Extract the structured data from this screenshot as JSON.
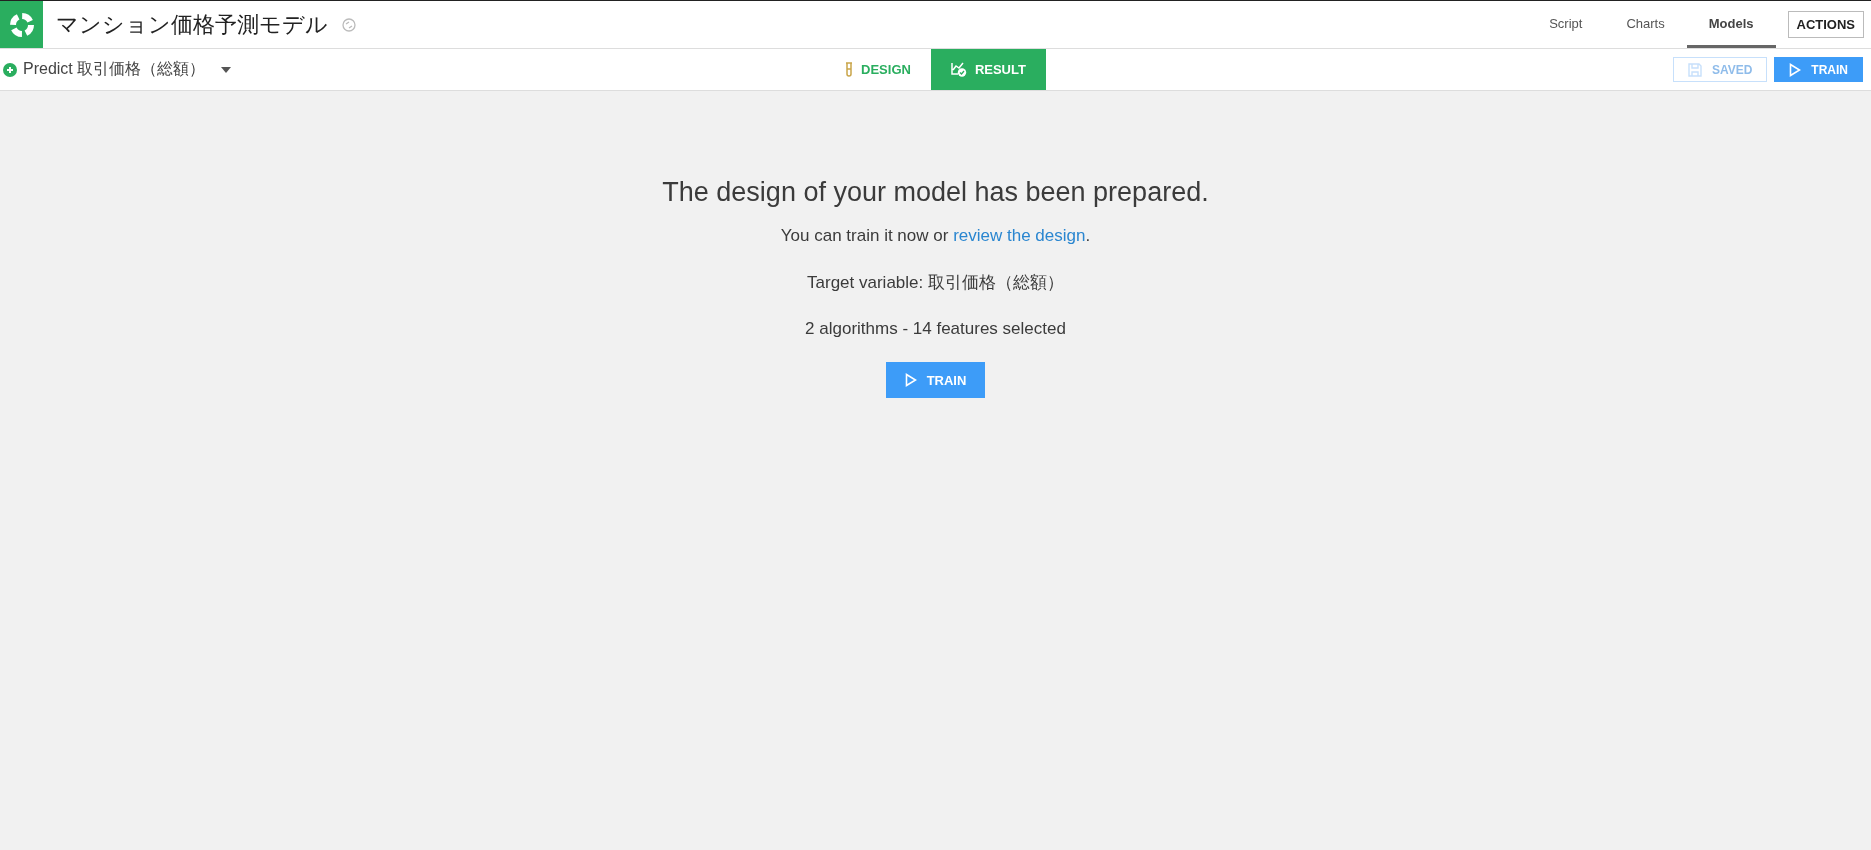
{
  "header": {
    "title": "マンション価格予測モデル",
    "nav": [
      {
        "label": "Script",
        "selected": false
      },
      {
        "label": "Charts",
        "selected": false
      },
      {
        "label": "Models",
        "selected": true
      }
    ],
    "actions": "ACTIONS"
  },
  "toolbar": {
    "predict": "Predict 取引価格（総額）",
    "tabs": [
      {
        "label": "DESIGN",
        "selected": false,
        "kind": "design"
      },
      {
        "label": "RESULT",
        "selected": true,
        "kind": "result"
      }
    ],
    "saved": {
      "label": "SAVED",
      "disabled": true
    },
    "train": "TRAIN"
  },
  "content": {
    "heading": "The design of your model has been prepared.",
    "intro": "You can train it now or ",
    "link": "review the design",
    "suffix": ".",
    "target": "Target variable: 取引価格（総額）",
    "summary": "2 algorithms - 14 features selected",
    "train": "TRAIN"
  }
}
